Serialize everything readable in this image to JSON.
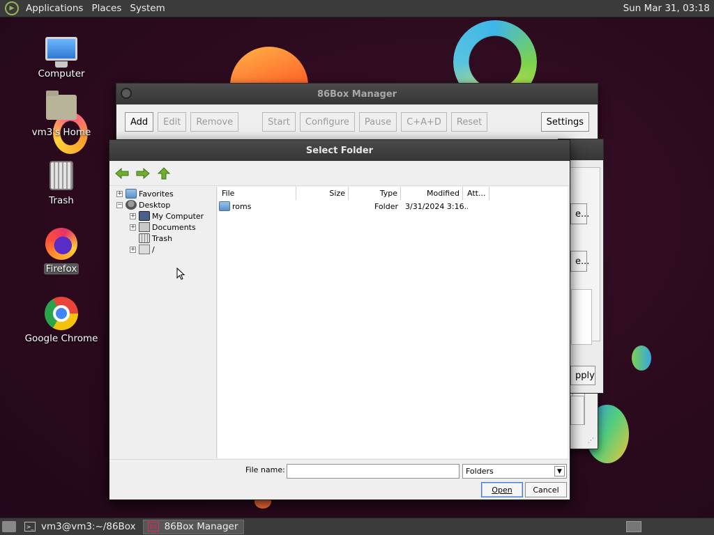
{
  "top_panel": {
    "menus": [
      "Applications",
      "Places",
      "System"
    ],
    "clock": "Sun Mar 31, 03:18"
  },
  "desktop_icons": [
    {
      "label": "Computer",
      "icon": "computer-icon"
    },
    {
      "label": "vm3's Home",
      "icon": "home-folder-icon"
    },
    {
      "label": "Trash",
      "icon": "trash-icon"
    },
    {
      "label": "Firefox",
      "icon": "firefox-icon"
    },
    {
      "label": "Google Chrome",
      "icon": "chrome-icon"
    }
  ],
  "manager": {
    "title": "86Box Manager",
    "buttons": {
      "add": "Add",
      "edit": "Edit",
      "remove": "Remove",
      "start": "Start",
      "configure": "Configure",
      "pause": "Pause",
      "cad": "C+A+D",
      "reset": "Reset",
      "settings": "Settings"
    }
  },
  "settings_peek": {
    "btn1": "e...",
    "btn2": "e...",
    "apply": "pply"
  },
  "dialog": {
    "title": "Select Folder",
    "tree": [
      {
        "label": "Favorites",
        "icon": "folder-icon",
        "expander": "+"
      },
      {
        "label": "Desktop",
        "icon": "desktop-icon",
        "expander": "−"
      },
      {
        "label": "My Computer",
        "icon": "computer-icon",
        "expander": "+"
      },
      {
        "label": "Documents",
        "icon": "documents-icon",
        "expander": "+"
      },
      {
        "label": "Trash",
        "icon": "trash-icon",
        "expander": ""
      },
      {
        "label": "/",
        "icon": "drive-icon",
        "expander": "+"
      }
    ],
    "columns": [
      "File",
      "Size",
      "Type",
      "Modified",
      "Att..."
    ],
    "rows": [
      {
        "file": "roms",
        "size": "",
        "type": "Folder",
        "modified": "3/31/2024 3:16...",
        "attr": ""
      }
    ],
    "file_name_label": "File name:",
    "file_name_value": "",
    "filter": "Folders",
    "open": "Open",
    "cancel": "Cancel"
  },
  "taskbar": {
    "tasks": [
      {
        "label": "vm3@vm3:~/86Box",
        "icon": "terminal-icon",
        "active": false
      },
      {
        "label": "86Box Manager",
        "icon": "86box-icon",
        "active": true
      }
    ]
  }
}
